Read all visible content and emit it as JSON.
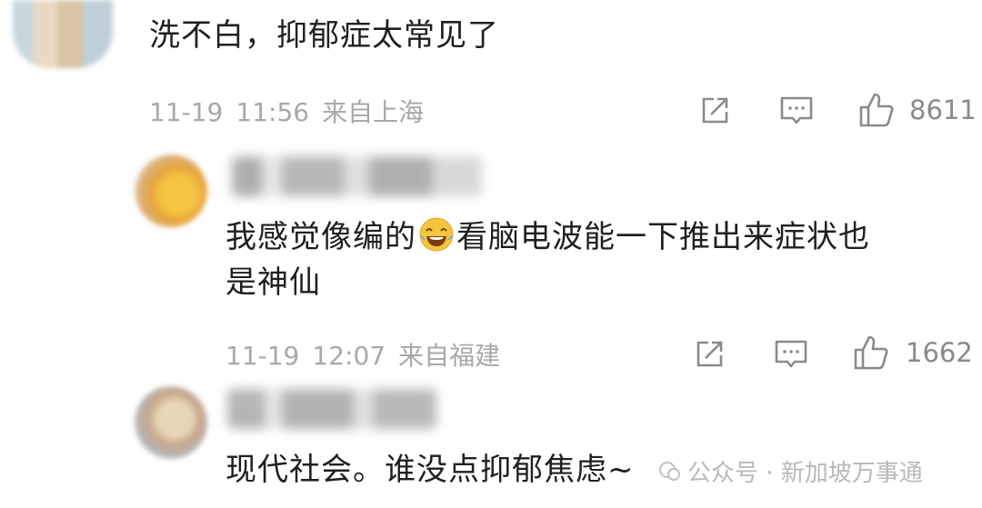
{
  "comments": [
    {
      "text": "洗不白，抑郁症太常见了",
      "date": "11-19",
      "time": "11:56",
      "location": "来自上海",
      "likes": "8611"
    },
    {
      "text_before_emoji": "我感觉像编的",
      "emoji": "laughing-tears-emoji",
      "text_after_emoji": "看脑电波能一下推出来症状也",
      "text_line2": "是神仙",
      "date": "11-19",
      "time": "12:07",
      "location": "来自福建",
      "likes": "1662"
    },
    {
      "text": "现代社会。谁没点抑郁焦虑~"
    }
  ],
  "watermark": {
    "label": "公众号 · 新加坡万事通"
  },
  "icons": {
    "share": "share-icon",
    "reply": "comment-icon",
    "like": "thumbs-up-icon"
  }
}
